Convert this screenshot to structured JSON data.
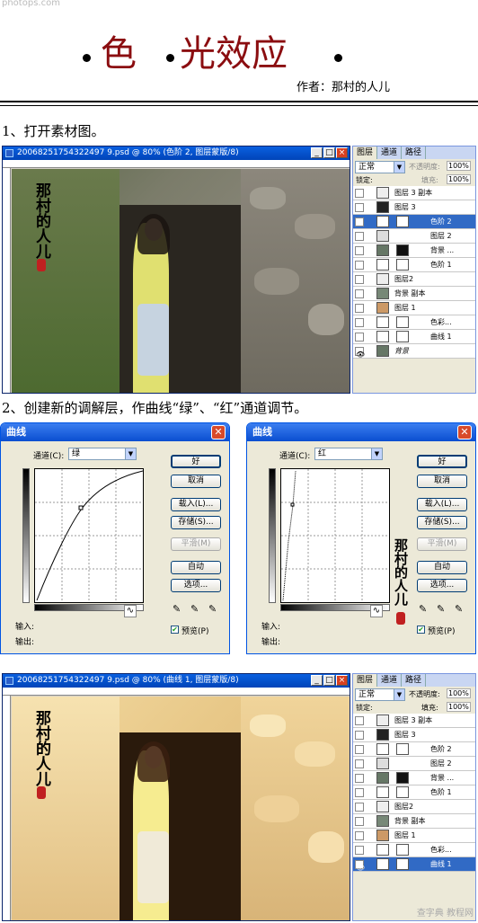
{
  "watermark_top": "photops.com",
  "title": {
    "chars": [
      "色",
      "光",
      "效",
      "应"
    ]
  },
  "author": "作者：那村的人儿",
  "steps": [
    "1、打开素材图。",
    "2、创建新的调解层，作曲线“绿”、“红”通道调节。"
  ],
  "window1": {
    "title": "20068251754322497 9.psd @ 80% (色阶 2, 图层蒙版/8)"
  },
  "window2": {
    "title": "20068251754322497 9.psd @ 80% (曲线 1, 图层蒙版/8)"
  },
  "layers": {
    "tabs": [
      "图层",
      "通道",
      "路径"
    ],
    "mode": "正常",
    "opacity_label": "不透明度:",
    "opacity": "100%",
    "lock_label": "锁定:",
    "fill_label": "填充:",
    "fill": "100%",
    "rows1": [
      "图层 3 副本",
      "图层 3",
      "色阶 2",
      "图层 2",
      "背景 ...",
      "色阶 1",
      "图层2",
      "背景 副本",
      "图层 1",
      "色彩...",
      "曲线 1",
      "背景"
    ],
    "rows2": [
      "图层 3 副本",
      "图层 3",
      "色阶 2",
      "图层 2",
      "背景 ...",
      "色阶 1",
      "图层2",
      "背景 副本",
      "图层 1",
      "色彩...",
      "曲线 1"
    ]
  },
  "curves": {
    "title": "曲线",
    "channel_label": "通道(C):",
    "channel_green": "绿",
    "channel_red": "红",
    "ok": "好",
    "cancel": "取消",
    "load": "载入(L)...",
    "save": "存储(S)...",
    "smooth": "平滑(M)",
    "auto": "自动",
    "options": "选项...",
    "input_label": "输入:",
    "output_label": "输出:",
    "preview": "预览(P)"
  },
  "signature": "那村的人儿",
  "bottom_watermark": "查字典 教程网"
}
